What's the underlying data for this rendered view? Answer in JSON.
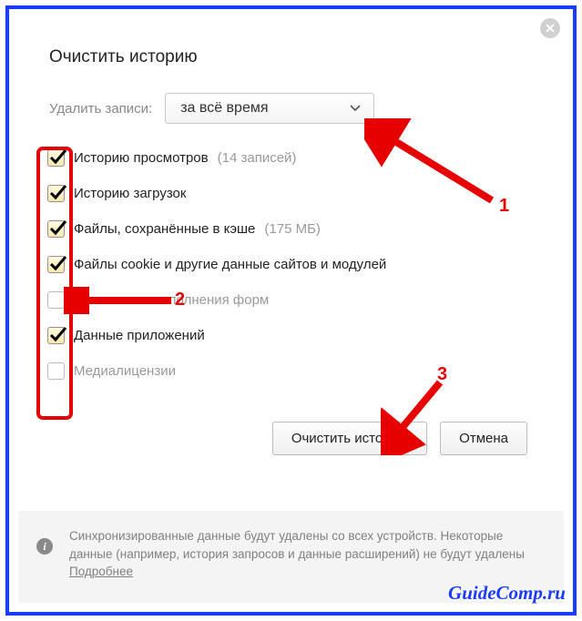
{
  "dialog": {
    "title": "Очистить историю",
    "close_icon": "✕",
    "time_label": "Удалить записи:",
    "time_value": "за всё время"
  },
  "checks": [
    {
      "label": "Историю просмотров",
      "extra": "(14 записей)",
      "checked": true
    },
    {
      "label": "Историю загрузок",
      "extra": "",
      "checked": true
    },
    {
      "label": "Файлы, сохранённые в кэше",
      "extra": "(175 МБ)",
      "checked": true
    },
    {
      "label": "Файлы cookie и другие данные сайтов и модулей",
      "extra": "",
      "checked": true
    },
    {
      "label": "Данные автозаполнения форм",
      "extra": "",
      "checked": false
    },
    {
      "label": "Данные приложений",
      "extra": "",
      "checked": true
    },
    {
      "label": "Медиалицензии",
      "extra": "",
      "checked": false
    }
  ],
  "actions": {
    "clear": "Очистить историю",
    "cancel": "Отмена"
  },
  "footer": {
    "text": "Синхронизированные данные будут удалены со всех устройств. Некоторые данные (например, история запросов и данные расширений) не будут удалены ",
    "link": "Подробнее"
  },
  "annotations": {
    "n1": "1",
    "n2": "2",
    "n3": "3"
  },
  "watermark": "GuideComp.ru"
}
